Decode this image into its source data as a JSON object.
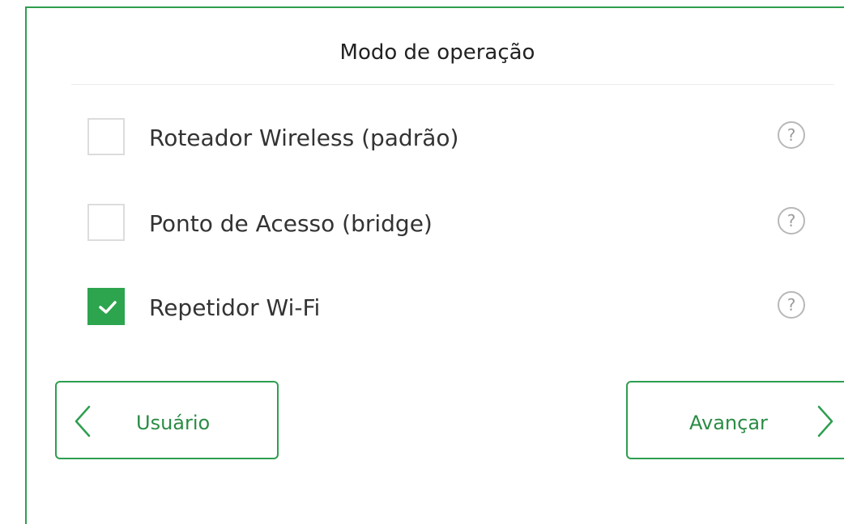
{
  "dialog": {
    "title": "Modo de operação"
  },
  "options": [
    {
      "label": "Roteador Wireless (padrão)",
      "checked": false,
      "help_icon": "question-circle-icon"
    },
    {
      "label": "Ponto de Acesso (bridge)",
      "checked": false,
      "help_icon": "question-circle-icon"
    },
    {
      "label": "Repetidor Wi-Fi",
      "checked": true,
      "help_icon": "question-circle-icon"
    }
  ],
  "help_glyph": "?",
  "buttons": {
    "back_label": "Usuário",
    "back_icon": "chevron-left-icon",
    "next_label": "Avançar",
    "next_icon": "chevron-right-icon"
  },
  "colors": {
    "accent": "#2da44e",
    "border": "#2e9e4f",
    "checkbox_border": "#dcdcdc"
  }
}
